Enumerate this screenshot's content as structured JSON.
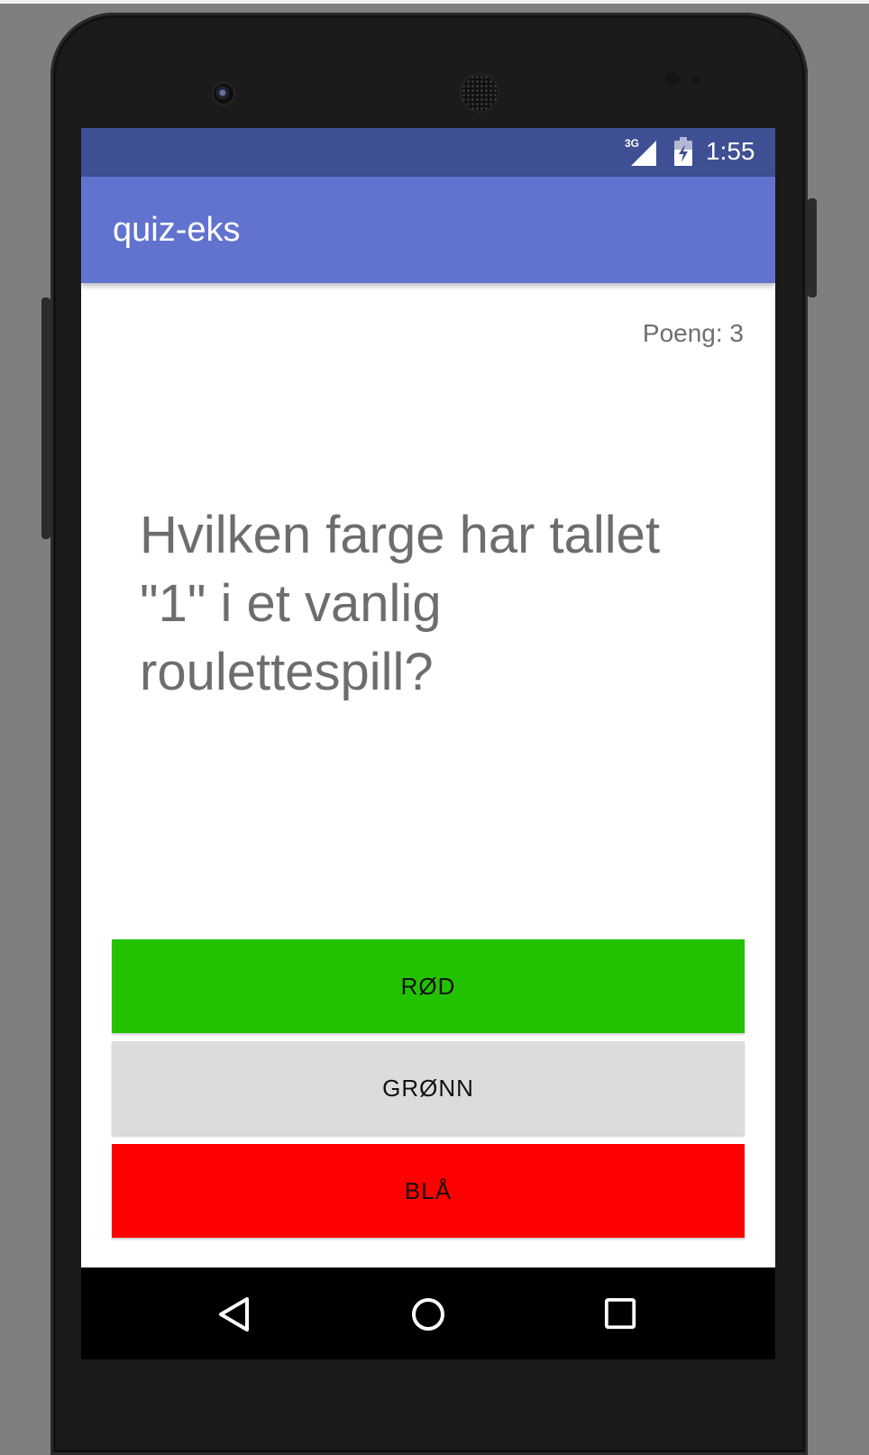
{
  "status_bar": {
    "network": "3G",
    "time": "1:55",
    "icons": [
      "signal-icon",
      "battery-icon"
    ]
  },
  "app_bar": {
    "title": "quiz-eks"
  },
  "quiz": {
    "score": "Poeng: 3",
    "question": "Hvilken farge har tallet \"1\" i et vanlig roulettespill?",
    "answers": [
      {
        "label": "RØD",
        "color": "#23c200"
      },
      {
        "label": "GRØNN",
        "color": "#dcdcdc"
      },
      {
        "label": "BLÅ",
        "color": "#ff0000"
      }
    ]
  },
  "nav_bar": {
    "icons": [
      "back-icon",
      "home-icon",
      "recents-icon"
    ]
  },
  "colors": {
    "status_bar": "#3f4f93",
    "app_bar": "#6273cf",
    "background": "#ffffff"
  }
}
